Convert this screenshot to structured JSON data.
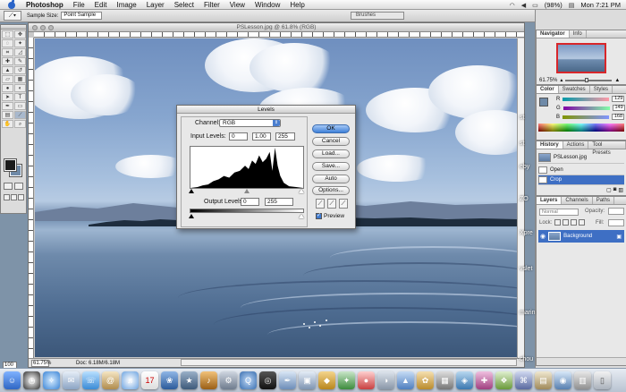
{
  "menubar": {
    "app_name": "Photoshop",
    "items": [
      "File",
      "Edit",
      "Image",
      "Layer",
      "Select",
      "Filter",
      "View",
      "Window",
      "Help"
    ],
    "battery": "(98%)",
    "clock": "Mon 7:21 PM"
  },
  "options_bar": {
    "sample_size_label": "Sample Size:",
    "sample_size_value": "Point Sample",
    "brushes_tab": "Brushes"
  },
  "document": {
    "title": "PSLesson.jpg @ 61.8% (RGB)",
    "zoom": "61.75%",
    "doc_info": "Doc: 6.18M/6.18M",
    "zoom_box": "100"
  },
  "levels_dialog": {
    "title": "Levels",
    "channel_label": "Channel:",
    "channel_value": "RGB",
    "input_levels_label": "Input Levels:",
    "input_black": "0",
    "input_gamma": "1.00",
    "input_white": "255",
    "output_levels_label": "Output Levels:",
    "output_black": "0",
    "output_white": "255",
    "buttons": {
      "ok": "OK",
      "cancel": "Cancel",
      "load": "Load...",
      "save": "Save...",
      "auto": "Auto",
      "options": "Options..."
    },
    "preview_label": "Preview",
    "preview_checked": true
  },
  "navigator": {
    "tabs": [
      "Navigator",
      "Info"
    ],
    "zoom_value": "61.75%"
  },
  "color_palette": {
    "tabs": [
      "Color",
      "Swatches",
      "Styles"
    ],
    "channels": [
      {
        "label": "R",
        "value": "129"
      },
      {
        "label": "G",
        "value": "149"
      },
      {
        "label": "B",
        "value": "168"
      }
    ]
  },
  "history": {
    "tabs": [
      "History",
      "Actions",
      "Tool Presets"
    ],
    "snapshot": "PSLesson.jpg",
    "states": [
      "Open",
      "Crop"
    ]
  },
  "layers": {
    "tabs": [
      "Layers",
      "Channels",
      "Paths"
    ],
    "blend_mode": "Normal",
    "opacity_label": "Opacity:",
    "lock_label": "Lock:",
    "fill_label": "Fill:",
    "layer_name": "Background"
  },
  "desktop_labels": [
    "st",
    "st",
    "eby",
    "ZO",
    "Xpre",
    "vslet",
    "marin",
    "chou"
  ],
  "dock_icons": [
    "finder",
    "clock",
    "safari",
    "mail",
    "ichat",
    "address-book",
    "itunes",
    "calendar",
    "iphoto",
    "imovie",
    "garageband",
    "system-prefs",
    "quicktime",
    "dvd-player",
    "photoshop",
    "app-1",
    "app-2",
    "app-3",
    "app-4",
    "app-5",
    "app-6",
    "app-7",
    "app-8",
    "app-9",
    "app-10",
    "app-11",
    "app-12",
    "app-13",
    "app-14",
    "app-15",
    "trash"
  ]
}
